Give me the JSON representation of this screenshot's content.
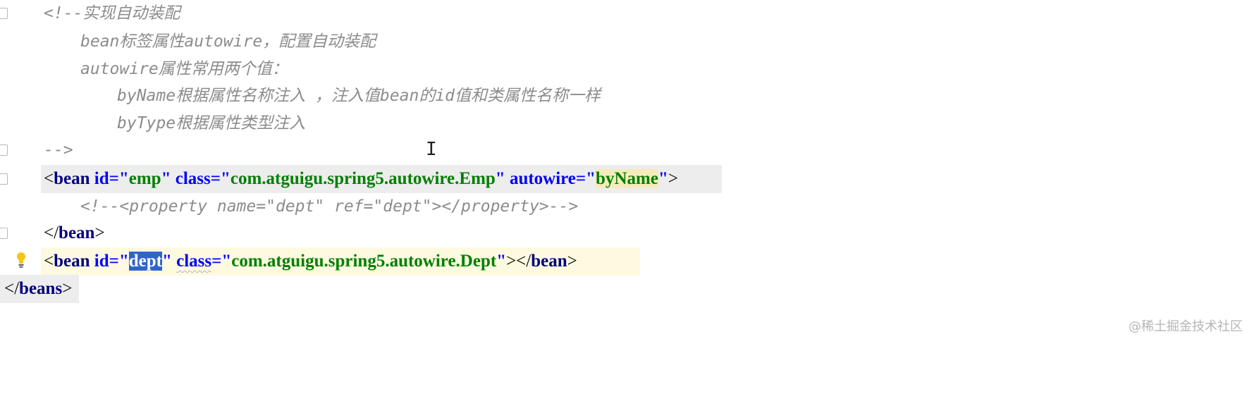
{
  "editor": {
    "comment_lines": [
      "<!--实现自动装配",
      "bean标签属性autowire，配置自动装配",
      "autowire属性常用两个值：",
      "byName根据属性名称注入 ，注入值bean的id值和类属性名称一样",
      "byType根据属性类型注入",
      "-->"
    ],
    "bean_emp": {
      "open": "<",
      "tag": "bean",
      "id_attr": "id",
      "eq_quote": "=\"",
      "id_val": "emp",
      "close_quote": "\"",
      "class_attr": "class",
      "class_val": "com.atguigu.spring5.autowire.Emp",
      "autowire_attr": "autowire",
      "autowire_val": "byName",
      "end": ">"
    },
    "property_comment": "<!--<property name=\"dept\" ref=\"dept\"></property>-->",
    "bean_close": {
      "open": "</",
      "tag": "bean",
      "end": ">"
    },
    "bean_dept": {
      "open": "<",
      "tag": "bean",
      "id_attr": "id",
      "id_val": "dept",
      "class_attr": "class",
      "class_val": "com.atguigu.spring5.autowire.Dept",
      "close_open": "></",
      "close_tag": "bean",
      "end": ">"
    },
    "beans_close": {
      "open": "</",
      "tag": "beans",
      "end": ">"
    }
  },
  "watermark": "@稀土掘金技术社区",
  "colors": {
    "tag": "#000080",
    "attribute": "#0000ff",
    "value": "#008000",
    "comment": "#8c8c8c",
    "selection": "#2f65ca",
    "current_line": "#fefae0"
  },
  "icons": [
    "fold-marker-icon",
    "lightbulb-icon",
    "text-cursor-icon"
  ]
}
